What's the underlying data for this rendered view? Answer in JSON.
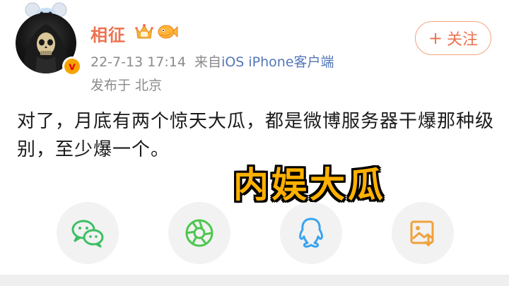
{
  "user": {
    "name": "相征",
    "avatar_badge": "v",
    "timestamp": "22-7-13 17:14",
    "source_prefix": "来自",
    "source": "iOS iPhone客户端",
    "location": "发布于 北京"
  },
  "follow": {
    "plus": "+",
    "label": "关注"
  },
  "post": {
    "text": "对了，月底有两个惊天大瓜，都是微博服务器干爆那种级别，至少爆一个。"
  },
  "overlay_caption": "内娱大瓜",
  "share_buttons": [
    {
      "icon": "wechat-icon",
      "color": "#3dbf63"
    },
    {
      "icon": "moments-icon",
      "color": "#4cc74f"
    },
    {
      "icon": "qq-icon",
      "color": "#3aa3f0"
    },
    {
      "icon": "save-image-icon",
      "color": "#f0a13b"
    }
  ],
  "colors": {
    "accent": "#eb7350",
    "link": "#5377b7",
    "meta": "#8a8a8a",
    "caption": "#ffb000"
  }
}
